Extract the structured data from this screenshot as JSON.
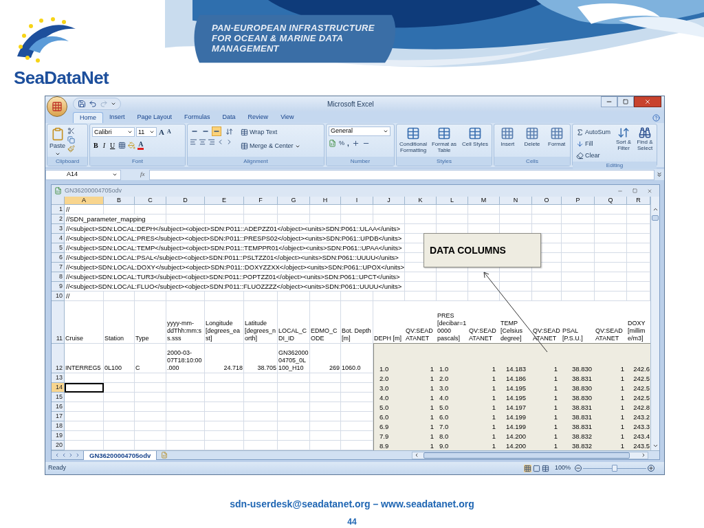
{
  "slide": {
    "header_lines": [
      "PAN-EUROPEAN INFRASTRUCTURE",
      "FOR OCEAN & MARINE DATA",
      "MANAGEMENT"
    ],
    "logo_text": "SeaDataNet",
    "footer_contact": "sdn-userdesk@seadatanet.org – www.seadatanet.org",
    "page_number": "44"
  },
  "window": {
    "title": "Microsoft Excel"
  },
  "ribbon": {
    "tabs": [
      {
        "label": "Home",
        "selected": true
      },
      {
        "label": "Insert",
        "selected": false
      },
      {
        "label": "Page Layout",
        "selected": false
      },
      {
        "label": "Formulas",
        "selected": false
      },
      {
        "label": "Data",
        "selected": false
      },
      {
        "label": "Review",
        "selected": false
      },
      {
        "label": "View",
        "selected": false
      }
    ],
    "clipboard": {
      "label": "Clipboard",
      "paste": "Paste"
    },
    "font": {
      "label": "Font",
      "family": "Calibri",
      "size": "11",
      "grow": "A",
      "shrink": "A",
      "bold": "B",
      "italic": "I",
      "underline": "U",
      "font_color": "A"
    },
    "alignment": {
      "label": "Alignment",
      "vertical": [
        {
          "selected": false
        },
        {
          "selected": false
        },
        {
          "selected": true
        }
      ],
      "wrap_text": "Wrap Text",
      "merge": "Merge & Center"
    },
    "number": {
      "label": "Number",
      "format": "General",
      "percent": "%",
      "comma": ","
    },
    "styles": {
      "label": "Styles",
      "buttons": [
        "Conditional Formatting",
        "Format as Table",
        "Cell Styles"
      ]
    },
    "cells": {
      "label": "Cells",
      "buttons": [
        "Insert",
        "Delete",
        "Format"
      ]
    },
    "editing": {
      "label": "Editing",
      "autosum": "AutoSum",
      "fill": "Fill",
      "clear": "Clear",
      "sort": "Sort & Filter",
      "find": "Find & Select"
    }
  },
  "formula_bar": {
    "name_box": "A14",
    "function_label": "fx"
  },
  "workbook": {
    "title": "GN36200004705odv"
  },
  "callout": {
    "text": "DATA COLUMNS"
  },
  "sheet": {
    "columns": [
      {
        "label": "A",
        "selected": true
      },
      {
        "label": "B",
        "selected": false
      },
      {
        "label": "C",
        "selected": false
      },
      {
        "label": "D",
        "selected": false
      },
      {
        "label": "E",
        "selected": false
      },
      {
        "label": "F",
        "selected": false
      },
      {
        "label": "G",
        "selected": false
      },
      {
        "label": "H",
        "selected": false
      },
      {
        "label": "I",
        "selected": false
      },
      {
        "label": "J",
        "selected": false
      },
      {
        "label": "K",
        "selected": false
      },
      {
        "label": "L",
        "selected": false
      },
      {
        "label": "M",
        "selected": false
      },
      {
        "label": "N",
        "selected": false
      },
      {
        "label": "O",
        "selected": false
      },
      {
        "label": "P",
        "selected": false
      },
      {
        "label": "Q",
        "selected": false
      },
      {
        "label": "R",
        "selected": false
      }
    ],
    "rows": [
      {
        "number": "1",
        "selected": false,
        "kind": "note",
        "text": "//"
      },
      {
        "number": "2",
        "selected": false,
        "kind": "note",
        "text": "//SDN_parameter_mapping"
      },
      {
        "number": "3",
        "selected": false,
        "kind": "note",
        "text": "//<subject>SDN:LOCAL:DEPH</subject><object>SDN:P011::ADEPZZ01</object><units>SDN:P061::ULAA</units>"
      },
      {
        "number": "4",
        "selected": false,
        "kind": "note",
        "text": "//<subject>SDN:LOCAL:PRES</subject><object>SDN:P011::PRESPS02</object><units>SDN:P061::UPDB</units>"
      },
      {
        "number": "5",
        "selected": false,
        "kind": "note",
        "text": "//<subject>SDN:LOCAL:TEMP</subject><object>SDN:P011::TEMPPR01</object><units>SDN:P061::UPAA</units>"
      },
      {
        "number": "6",
        "selected": false,
        "kind": "note",
        "text": "//<subject>SDN:LOCAL:PSAL</subject><object>SDN:P011::PSLTZZ01</object><units>SDN:P061::UUUU</units>"
      },
      {
        "number": "7",
        "selected": false,
        "kind": "note",
        "text": "//<subject>SDN:LOCAL:DOXY</subject><object>SDN:P011::DOXYZZXX</object><units>SDN:P061::UPOX</units>"
      },
      {
        "number": "8",
        "selected": false,
        "kind": "note",
        "text": "//<subject>SDN:LOCAL:TUR3</subject><object>SDN:P011::POPTZZ01</object><units>SDN:P061::UPCT</units>"
      },
      {
        "number": "9",
        "selected": false,
        "kind": "note",
        "text": "//<subject>SDN:LOCAL:FLUO</subject><object>SDN:P011::FLUOZZZZ</object><units>SDN:P061::UUUU</units>"
      },
      {
        "number": "10",
        "selected": false,
        "kind": "note",
        "text": "//"
      },
      {
        "number": "11",
        "selected": false,
        "kind": "header",
        "cells": [
          "Cruise",
          "Station",
          "Type",
          "yyyy-mm-ddThh:mm:ss.sss",
          "Longitude [degrees_east]",
          "Latitude [degrees_north]",
          "LOCAL_CDI_ID",
          "EDMO_CODE",
          "Bot. Depth [m]",
          "DEPH [m]",
          "QV:SEADATANET",
          "PRES [decibar=10000 pascals]",
          "QV:SEADATANET",
          "TEMP [Celsius degree]",
          "QV:SEADATANET",
          "PSAL [P.S.U.]",
          "QV:SEADATANET",
          "DOXY [millim e/m3]"
        ]
      },
      {
        "number": "12",
        "selected": false,
        "kind": "record",
        "cells": [
          "INTERREG5",
          "0L100",
          "C",
          "2000-03-07T18:10:00.000",
          "24.718",
          "38.705",
          "GN36200004705_0L100_H10",
          "269",
          "1060.0"
        ],
        "values": [
          "1.0",
          "1",
          "1.0",
          "1",
          "14.183",
          "1",
          "38.830",
          "1",
          "242.6"
        ]
      },
      {
        "number": "13",
        "selected": false,
        "kind": "values",
        "values": [
          "2.0",
          "1",
          "2.0",
          "1",
          "14.186",
          "1",
          "38.831",
          "1",
          "242.5"
        ]
      },
      {
        "number": "14",
        "selected": true,
        "kind": "values",
        "values": [
          "3.0",
          "1",
          "3.0",
          "1",
          "14.195",
          "1",
          "38.830",
          "1",
          "242.5"
        ]
      },
      {
        "number": "15",
        "selected": false,
        "kind": "values",
        "values": [
          "4.0",
          "1",
          "4.0",
          "1",
          "14.195",
          "1",
          "38.830",
          "1",
          "242.5"
        ]
      },
      {
        "number": "16",
        "selected": false,
        "kind": "values",
        "values": [
          "5.0",
          "1",
          "5.0",
          "1",
          "14.197",
          "1",
          "38.831",
          "1",
          "242.8"
        ]
      },
      {
        "number": "17",
        "selected": false,
        "kind": "values",
        "values": [
          "6.0",
          "1",
          "6.0",
          "1",
          "14.199",
          "1",
          "38.831",
          "1",
          "243.2"
        ]
      },
      {
        "number": "18",
        "selected": false,
        "kind": "values",
        "values": [
          "6.9",
          "1",
          "7.0",
          "1",
          "14.199",
          "1",
          "38.831",
          "1",
          "243.3"
        ]
      },
      {
        "number": "19",
        "selected": false,
        "kind": "values",
        "values": [
          "7.9",
          "1",
          "8.0",
          "1",
          "14.200",
          "1",
          "38.832",
          "1",
          "243.4"
        ]
      },
      {
        "number": "20",
        "selected": false,
        "kind": "values",
        "values": [
          "8.9",
          "1",
          "9.0",
          "1",
          "14.200",
          "1",
          "38.832",
          "1",
          "243.5"
        ]
      }
    ]
  },
  "sheet_tabs": [
    {
      "label": "GN36200004705odv",
      "selected": true
    }
  ],
  "status_bar": {
    "text": "Ready",
    "zoom": "100%",
    "zoom_slider": {
      "level": 0.5
    }
  }
}
